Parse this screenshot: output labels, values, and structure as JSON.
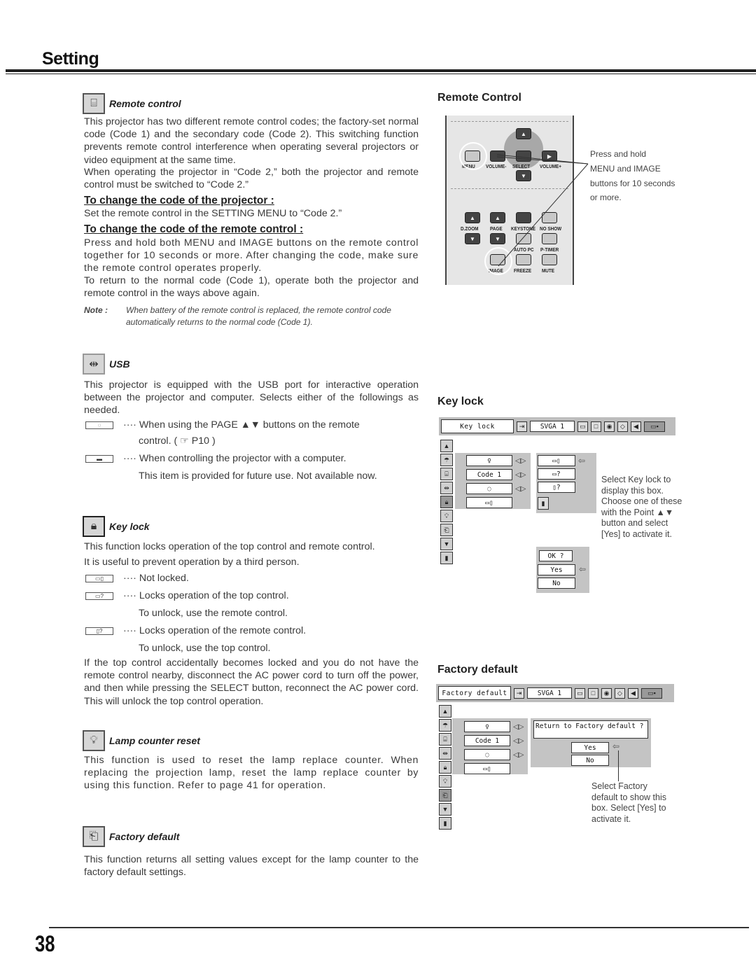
{
  "header": {
    "title": "Setting"
  },
  "left": {
    "remote_control": {
      "icon": "remote-control-icon",
      "title": "Remote control",
      "para": [
        "This projector has two different remote control codes; the factory-set normal code (Code 1) and the secondary code (Code 2).  This switching function prevents remote control interference when operating several projectors or video equipment at the same time.",
        "When operating the projector in “Code 2,”  both the projector and remote control must be switched to “Code 2.”"
      ],
      "sub1_title": "To change the code of the projector :",
      "sub1_text": "Set the remote control in the SETTING MENU to “Code 2.”",
      "sub2_title": "To change the code of the remote control :",
      "sub2_text": [
        "Press and hold both MENU and IMAGE buttons on the remote control together for 10 seconds or more. After changing the code, make sure the remote control operates properly.",
        "To return to the normal code (Code 1), operate both the projector and remote control in the ways above again."
      ],
      "note_label": "Note :",
      "note_text": "When battery of the remote control is replaced, the remote control code automatically returns to the normal code (Code 1)."
    },
    "usb": {
      "icon": "usb-icon",
      "title": "USB",
      "para": "This projector is equipped with the USB port for interactive operation between the projector and computer. Selects either of the followings as needed.",
      "options": [
        {
          "icon": "mouse-icon",
          "glyph": "◌",
          "text": "When using the PAGE ▲▼ buttons on the remote",
          "cont": "control.  ( ☞ P10 )"
        },
        {
          "icon": "projector-icon",
          "glyph": "▬",
          "text": "When controlling the projector with a computer.",
          "cont": "This item is provided for future use. Not available now."
        }
      ]
    },
    "key_lock": {
      "icon": "lock-icon",
      "title": "Key lock",
      "para1": "This function locks operation of the top control and remote control.",
      "para2": "It is useful to prevent operation by a third person.",
      "options": [
        {
          "icon": "unlocked-icon",
          "glyph": "▭▯",
          "text": "Not locked.",
          "cont": ""
        },
        {
          "icon": "top-control-lock-icon",
          "glyph": "▭?",
          "text": "Locks operation of the top control.",
          "cont": "To unlock, use the remote control."
        },
        {
          "icon": "remote-lock-icon",
          "glyph": "▯?",
          "text": "Locks operation of the remote control.",
          "cont": "To unlock, use the top control."
        }
      ],
      "para3": "If the top control accidentally becomes locked and you do not have the remote control nearby, disconnect the AC power cord to turn off the power, and then while pressing the SELECT button, reconnect the AC power cord.  This will unlock the top control operation."
    },
    "lamp_reset": {
      "icon": "lamp-icon",
      "title": "Lamp counter reset",
      "para": "This function is used to reset the lamp replace counter.  When replacing the projection lamp, reset the lamp replace counter by using this function.  Refer to page 41 for operation."
    },
    "factory_default": {
      "icon": "factory-default-icon",
      "title": "Factory default",
      "para": "This function returns all setting values except for the lamp counter to the factory default settings."
    },
    "dots": "····"
  },
  "right": {
    "remote": {
      "heading": "Remote Control",
      "buttons": {
        "menu": "MENU",
        "vol_minus": "VOLUME-",
        "select": "SELECT",
        "vol_plus": "VOLUME+",
        "dzoom": "D.ZOOM",
        "page": "PAGE",
        "keystone": "KEYSTONE",
        "noshow": "NO SHOW",
        "autopc": "AUTO PC",
        "ptimer": "P-TIMER",
        "image": "IMAGE",
        "freeze": "FREEZE",
        "mute": "MUTE"
      },
      "caption": [
        "Press and hold",
        "MENU and IMAGE",
        "buttons for 10 seconds",
        "or more."
      ]
    },
    "key_lock": {
      "heading": "Key lock",
      "menu_title": "Key lock",
      "source": "SVGA 1",
      "field_code": "Code 1",
      "ok": "OK ?",
      "yes": "Yes",
      "no": "No",
      "caption": "Select Key lock to display this box. Choose one of these with the Point ▲▼ button and select [Yes] to activate it."
    },
    "factory_default": {
      "heading": "Factory default",
      "menu_title": "Factory default",
      "source": "SVGA 1",
      "field_code": "Code 1",
      "question": "Return to Factory default ?",
      "yes": "Yes",
      "no": "No",
      "caption": "Select Factory default to show this box. Select [Yes] to activate it."
    }
  },
  "footer": {
    "page_number": "38"
  }
}
